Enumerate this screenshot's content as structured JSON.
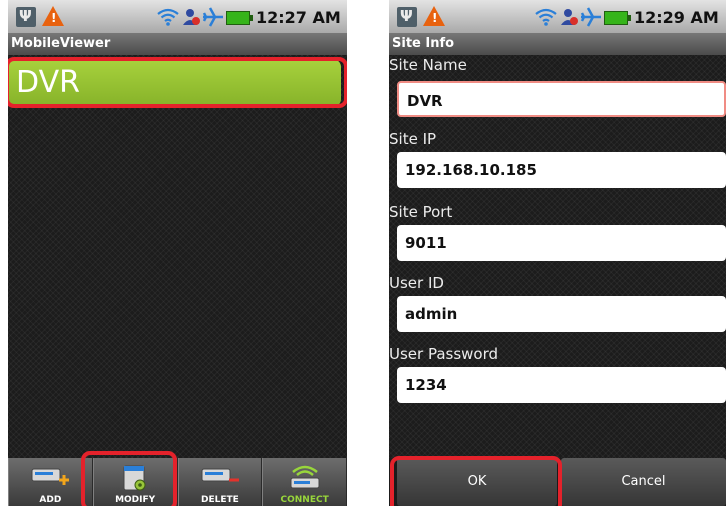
{
  "left_screen": {
    "status": {
      "time": "12:27 AM"
    },
    "title": "MobileViewer",
    "sites": [
      {
        "name": "DVR"
      }
    ],
    "toolbar": [
      {
        "label": "ADD",
        "icon": "add-device-icon"
      },
      {
        "label": "MODIFY",
        "icon": "modify-settings-icon"
      },
      {
        "label": "DELETE",
        "icon": "delete-device-icon"
      },
      {
        "label": "CONNECT",
        "icon": "connect-wireless-icon"
      }
    ]
  },
  "right_screen": {
    "status": {
      "time": "12:29 AM"
    },
    "title": "Site Info",
    "fields": [
      {
        "label": "Site Name",
        "value": "DVR"
      },
      {
        "label": "Site IP",
        "value": "192.168.10.185"
      },
      {
        "label": "Site Port",
        "value": "9011"
      },
      {
        "label": "User ID",
        "value": "admin"
      },
      {
        "label": "User Password",
        "value": "1234"
      }
    ],
    "buttons": {
      "ok": "OK",
      "cancel": "Cancel"
    }
  },
  "colors": {
    "highlight": "#e4222b",
    "selected_row": "#9ac834",
    "connect_label": "#98d63b"
  }
}
